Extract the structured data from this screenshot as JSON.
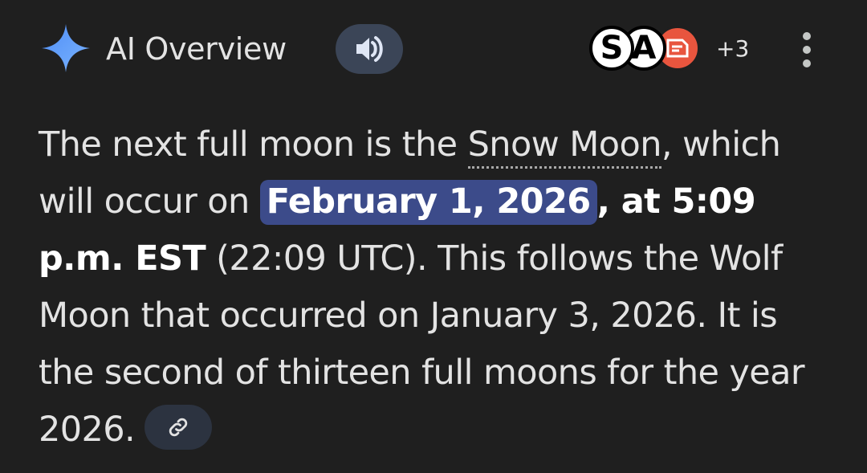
{
  "header": {
    "icon": "sparkle-icon",
    "title": "AI Overview",
    "listen_icon": "speaker-icon",
    "sources": [
      {
        "label": "S"
      },
      {
        "label": "A"
      },
      {
        "icon": "source-logo-icon",
        "color": "#e8553e"
      }
    ],
    "more_sources": "+3",
    "menu_icon": "more-vert-icon"
  },
  "answer": {
    "seg1": "The next full moon is the ",
    "snow_moon": "Snow Moon",
    "seg2": ", which will occur on ",
    "highlight_date": "February 1, 2026",
    "bold_time": ", at 5:09 p.m. EST",
    "seg3": " (22:09 UTC). This follows the Wolf Moon that occurred on January 3, 2026. It is the second of thirteen full moons for the year 2026.",
    "citation_icon": "link-icon"
  },
  "colors": {
    "background": "#1f1f1f",
    "highlight": "#3c4b8a",
    "speaker_button": "#3b4557",
    "citation_button": "#2c3340",
    "sparkle": "#5b9cf6"
  }
}
